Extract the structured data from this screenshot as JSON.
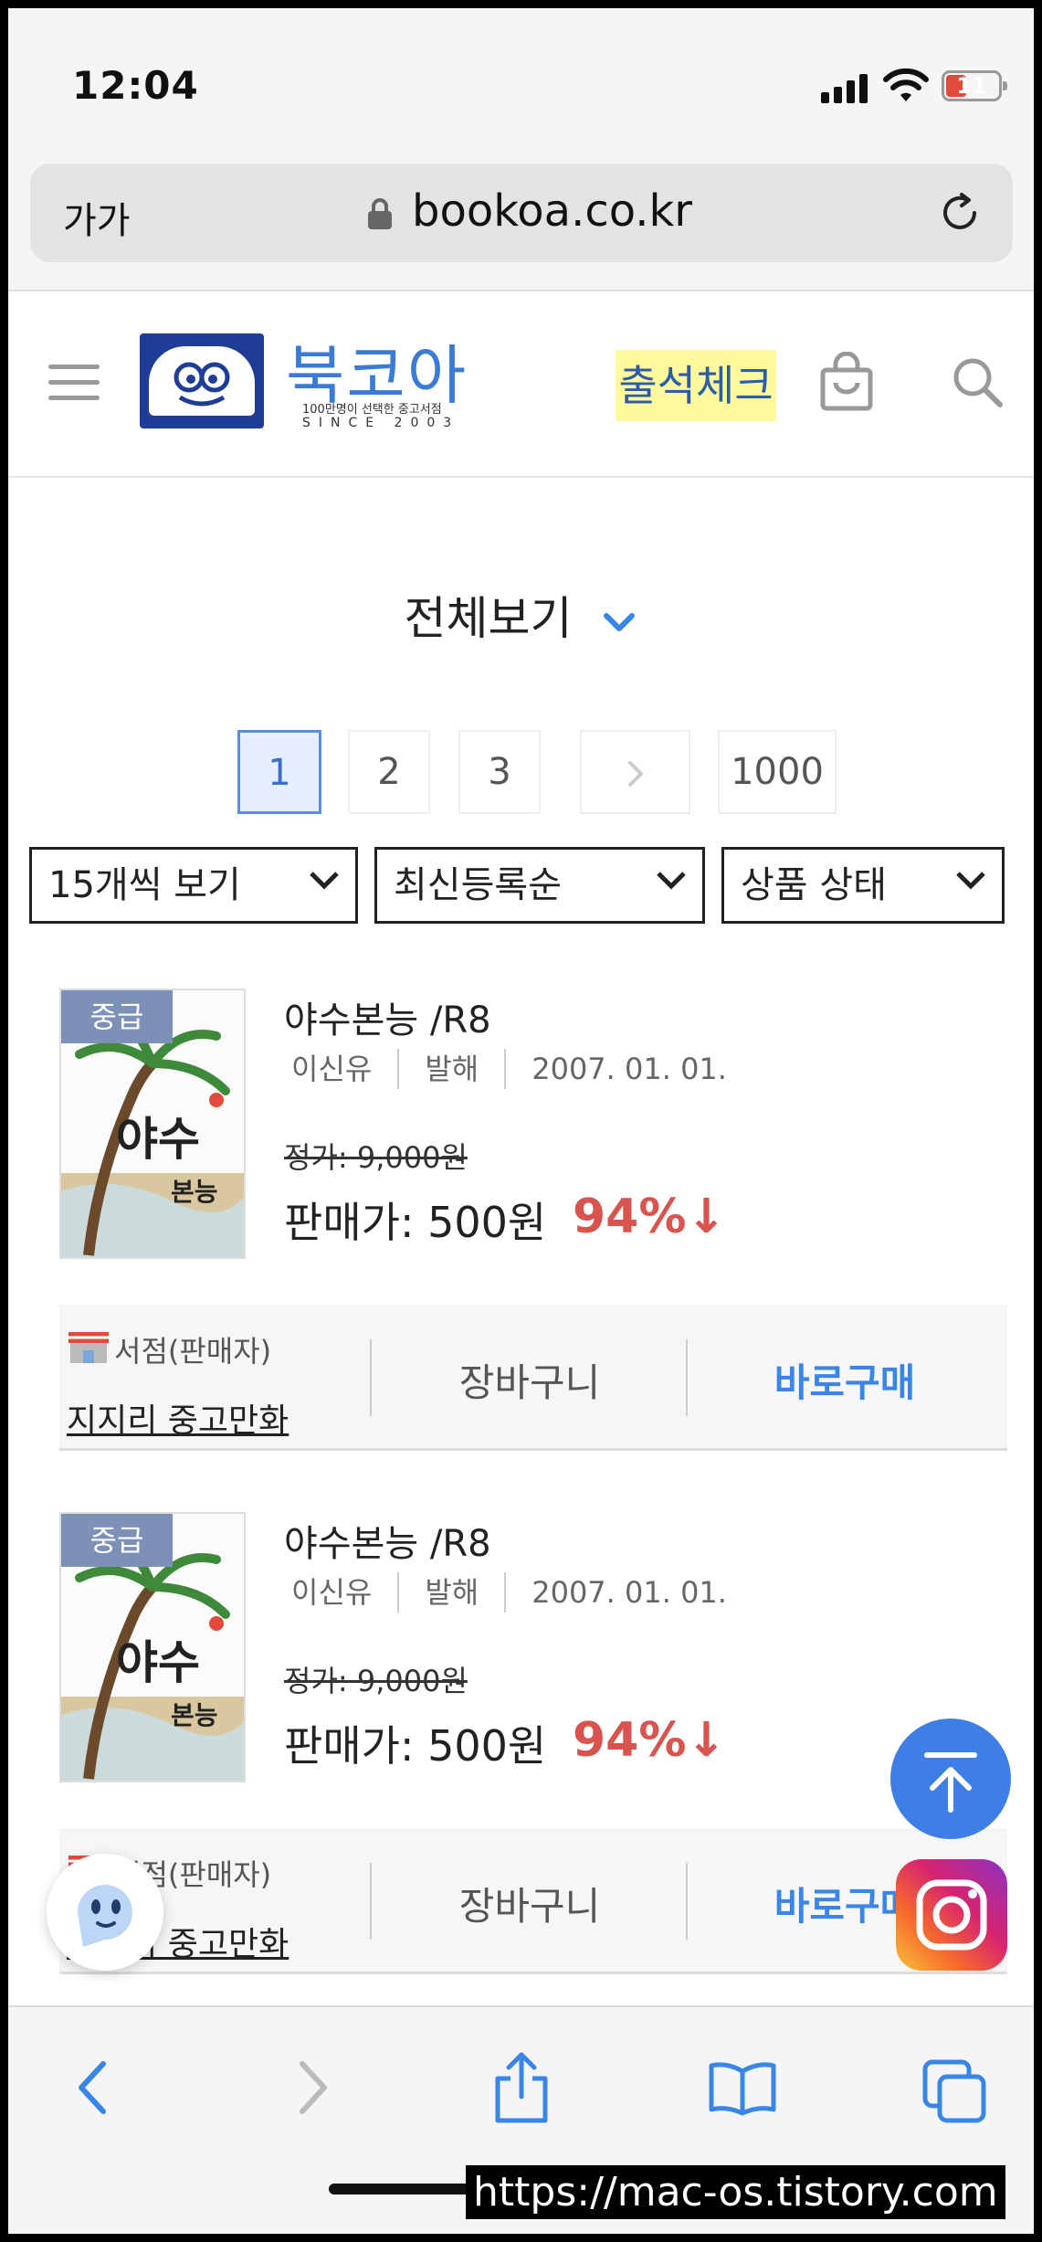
{
  "status_bar": {
    "time": "12:04",
    "battery": "11"
  },
  "browser": {
    "text_size_label": "가가",
    "url": "bookoa.co.kr"
  },
  "site": {
    "logo_name": "북코아",
    "logo_tagline": "100만명이 선택한 중고서점",
    "logo_since": "SINCE 2003",
    "attendance_label": "출석체크"
  },
  "listing": {
    "title": "전체보기",
    "pages": [
      "1",
      "2",
      "3",
      "1000"
    ],
    "active_page": "1",
    "per_page_select": "15개씩 보기",
    "sort_select": "최신등록순",
    "condition_select": "상품 상태"
  },
  "products": [
    {
      "badge": "중급",
      "title": "야수본능 /R8",
      "author": "이신유",
      "publisher": "발해",
      "date": "2007. 01. 01.",
      "list_price": "정가: 9,000원",
      "sale_price": "판매가: 500원",
      "discount": "94%↓",
      "cover_text_1": "야수",
      "cover_text_2": "본능",
      "seller_label": "서점(판매자)",
      "seller_name": "지지리 중고만화",
      "cart_label": "장바구니",
      "buy_label": "바로구매"
    },
    {
      "badge": "중급",
      "title": "야수본능 /R8",
      "author": "이신유",
      "publisher": "발해",
      "date": "2007. 01. 01.",
      "list_price": "정가: 9,000원",
      "sale_price": "판매가: 500원",
      "discount": "94%↓",
      "cover_text_1": "야수",
      "cover_text_2": "본능",
      "seller_label": "서점(판매자)",
      "seller_name": "지지리 중고만화",
      "cart_label": "장바구니",
      "buy_label": "바로구매"
    }
  ],
  "watermark": "https://mac-os.tistory.com",
  "colors": {
    "accent_blue": "#3a86e8",
    "discount_red": "#d9534f",
    "highlight_yellow": "#fff89c",
    "logo_navy": "#1f3c97"
  }
}
